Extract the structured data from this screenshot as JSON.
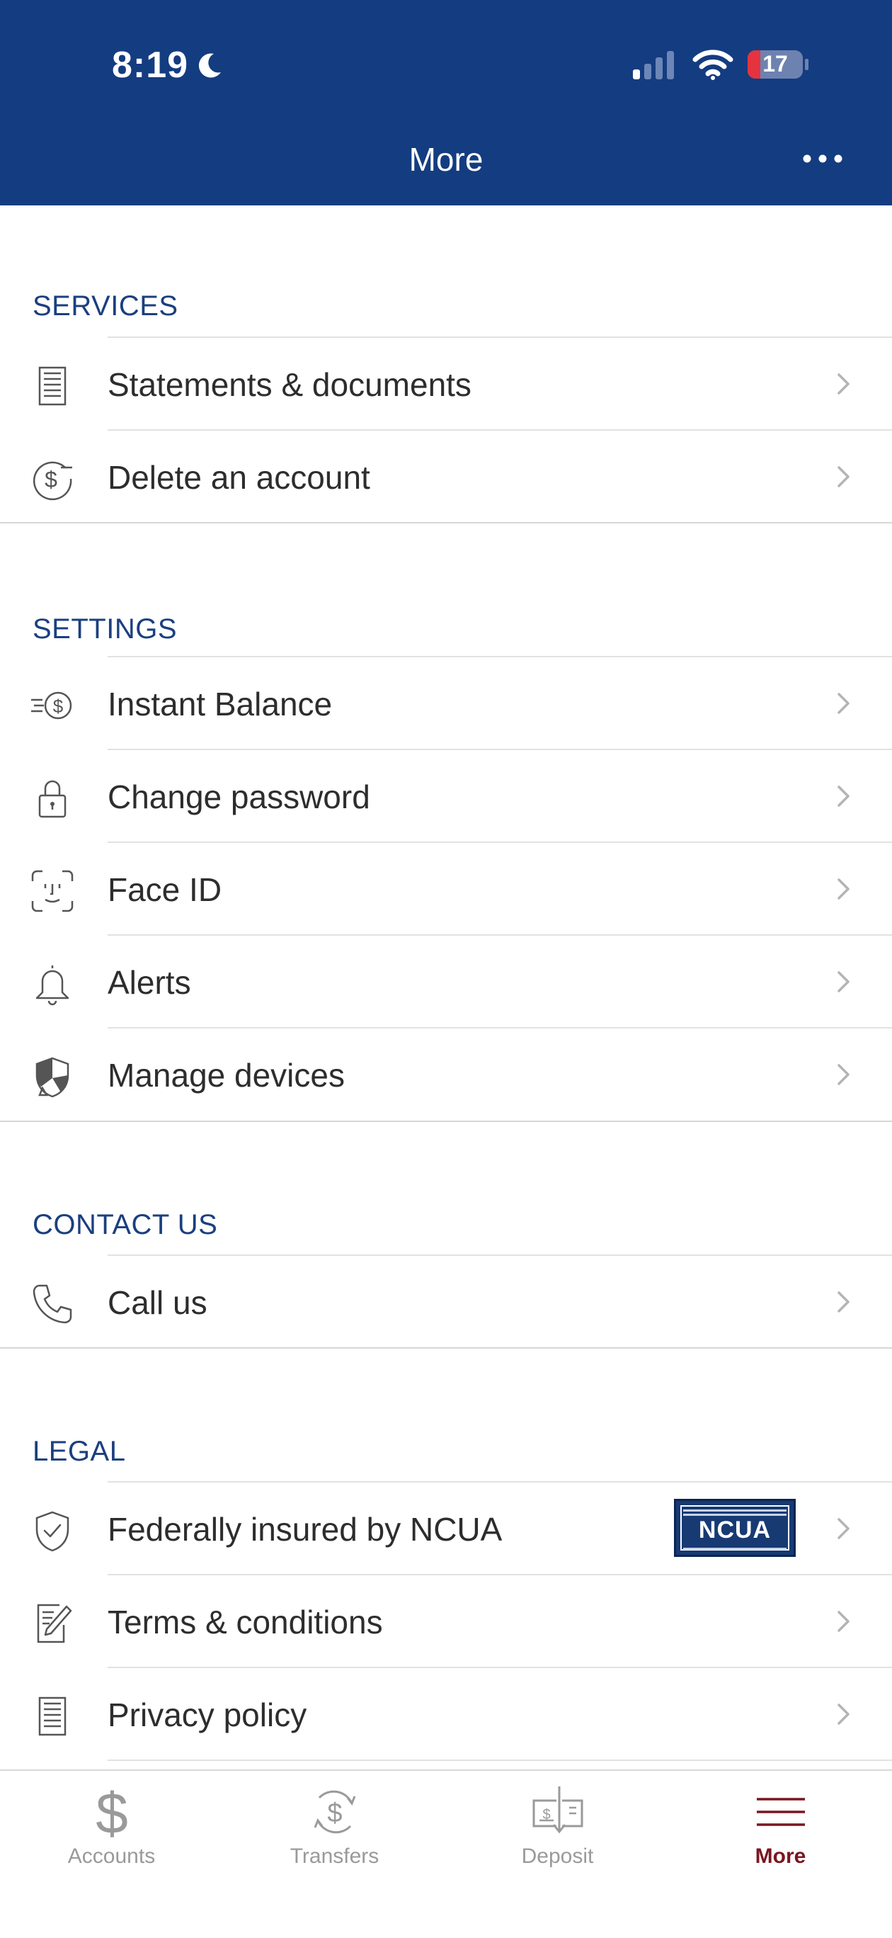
{
  "status_bar": {
    "time": "8:19",
    "battery": "17"
  },
  "header": {
    "title": "More",
    "menu_icon": "ellipsis-icon"
  },
  "colors": {
    "header_bg": "#143c80",
    "section_title": "#1b3f80",
    "active_tab": "#7a1620",
    "battery_low": "#e5333f"
  },
  "sections": [
    {
      "title": "SERVICES",
      "items": [
        {
          "label": "Statements & documents",
          "icon": "document-icon"
        },
        {
          "label": "Delete an account",
          "icon": "dollar-remove-icon"
        }
      ]
    },
    {
      "title": "SETTINGS",
      "items": [
        {
          "label": "Instant Balance",
          "icon": "instant-balance-icon"
        },
        {
          "label": "Change password",
          "icon": "lock-icon"
        },
        {
          "label": "Face ID",
          "icon": "face-id-icon"
        },
        {
          "label": "Alerts",
          "icon": "bell-icon"
        },
        {
          "label": "Manage devices",
          "icon": "shield-devices-icon"
        }
      ]
    },
    {
      "title": "CONTACT US",
      "items": [
        {
          "label": "Call us",
          "icon": "phone-icon"
        }
      ]
    },
    {
      "title": "LEGAL",
      "items": [
        {
          "label": "Federally insured by NCUA",
          "icon": "shield-check-icon",
          "badge": "NCUA"
        },
        {
          "label": "Terms & conditions",
          "icon": "document-edit-icon"
        },
        {
          "label": "Privacy policy",
          "icon": "document-icon"
        }
      ]
    }
  ],
  "tabs": [
    {
      "label": "Accounts",
      "icon": "dollar-icon",
      "active": false
    },
    {
      "label": "Transfers",
      "icon": "transfer-icon",
      "active": false
    },
    {
      "label": "Deposit",
      "icon": "check-deposit-icon",
      "active": false
    },
    {
      "label": "More",
      "icon": "hamburger-icon",
      "active": true
    }
  ]
}
